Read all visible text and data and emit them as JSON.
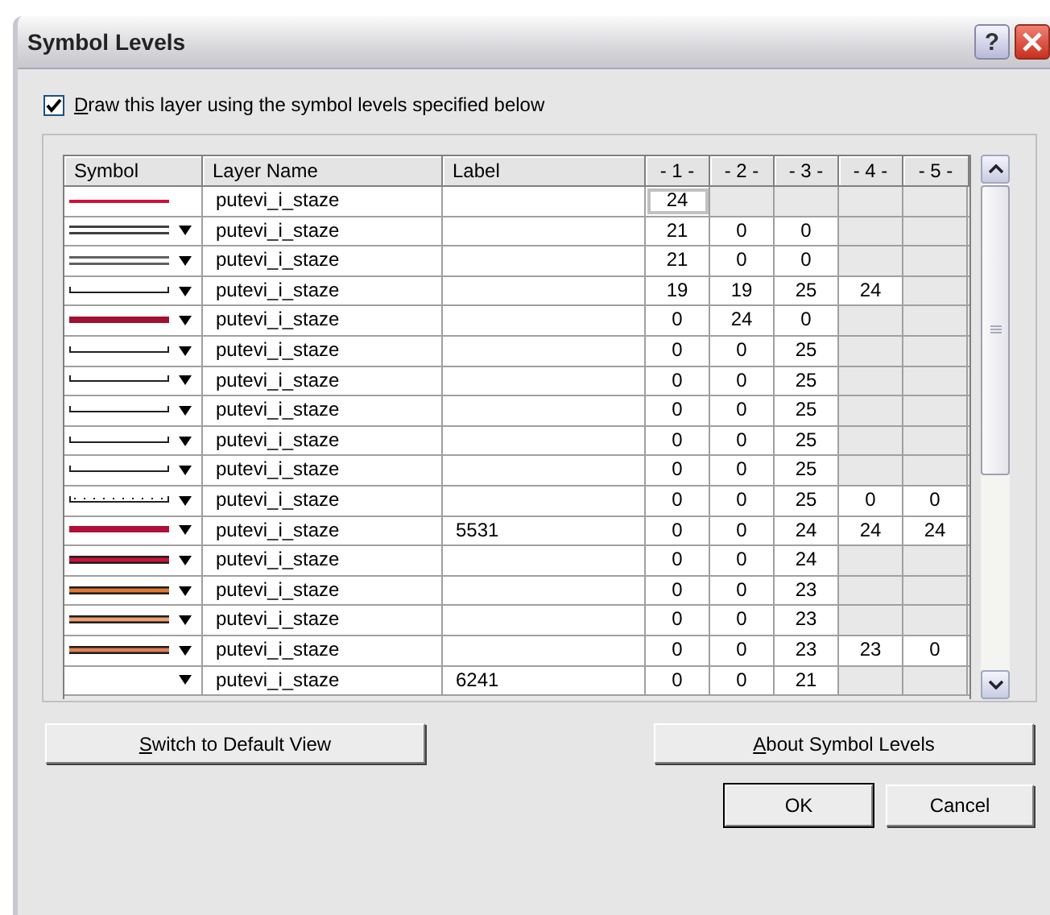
{
  "window": {
    "title": "Symbol Levels",
    "help_button": "?"
  },
  "draw_levels": {
    "label": "Draw this layer using the symbol levels specified below",
    "checked": true,
    "underline_first": true
  },
  "table": {
    "columns": [
      "Symbol",
      "Layer Name",
      "Label",
      "- 1 -",
      "- 2 -",
      "- 3 -",
      "- 4 -",
      "- 5 -"
    ],
    "rows": [
      {
        "symbol": {
          "kind": "line",
          "color": "#d0103a",
          "dropdown": false
        },
        "layer": "putevi_i_staze",
        "levels": [
          {
            "value": "24",
            "disabled": false
          },
          {
            "disabled": true
          },
          {
            "disabled": true
          },
          {
            "disabled": true
          },
          {
            "disabled": true
          }
        ],
        "focused": true
      },
      {
        "symbol": {
          "kind": "double",
          "color": "#404040",
          "dropdown": true
        },
        "layer": "putevi_i_staze",
        "levels": [
          {
            "value": "21",
            "disabled": false
          },
          {
            "value": "0",
            "disabled": false
          },
          {
            "value": "0",
            "disabled": false
          },
          {
            "disabled": true
          },
          {
            "disabled": true
          }
        ],
        "focused": false
      },
      {
        "symbol": {
          "kind": "double",
          "color": "#606060",
          "dropdown": true
        },
        "layer": "putevi_i_staze",
        "levels": [
          {
            "value": "21",
            "disabled": false
          },
          {
            "value": "0",
            "disabled": false
          },
          {
            "value": "0",
            "disabled": false
          },
          {
            "disabled": true
          },
          {
            "disabled": true
          }
        ],
        "focused": false
      },
      {
        "symbol": {
          "kind": "ticked",
          "color": "#202020",
          "dropdown": true
        },
        "layer": "putevi_i_staze",
        "levels": [
          {
            "value": "19",
            "disabled": false
          },
          {
            "value": "19",
            "disabled": false
          },
          {
            "value": "25",
            "disabled": false
          },
          {
            "value": "24",
            "disabled": false
          },
          {
            "disabled": true
          }
        ],
        "focused": false
      },
      {
        "symbol": {
          "kind": "thick",
          "color": "#a01030",
          "dropdown": true
        },
        "layer": "putevi_i_staze",
        "levels": [
          {
            "value": "0",
            "disabled": false
          },
          {
            "value": "24",
            "disabled": false
          },
          {
            "value": "0",
            "disabled": false
          },
          {
            "disabled": true
          },
          {
            "disabled": true
          }
        ],
        "focused": false
      },
      {
        "symbol": {
          "kind": "ticked",
          "color": "#202020",
          "dropdown": true
        },
        "layer": "putevi_i_staze",
        "levels": [
          {
            "value": "0",
            "disabled": false
          },
          {
            "value": "0",
            "disabled": false
          },
          {
            "value": "25",
            "disabled": false
          },
          {
            "disabled": true
          },
          {
            "disabled": true
          }
        ],
        "focused": false
      },
      {
        "symbol": {
          "kind": "ticked",
          "color": "#202020",
          "dropdown": true
        },
        "layer": "putevi_i_staze",
        "levels": [
          {
            "value": "0",
            "disabled": false
          },
          {
            "value": "0",
            "disabled": false
          },
          {
            "value": "25",
            "disabled": false
          },
          {
            "disabled": true
          },
          {
            "disabled": true
          }
        ],
        "focused": false
      },
      {
        "symbol": {
          "kind": "ticked",
          "color": "#202020",
          "dropdown": true
        },
        "layer": "putevi_i_staze",
        "levels": [
          {
            "value": "0",
            "disabled": false
          },
          {
            "value": "0",
            "disabled": false
          },
          {
            "value": "25",
            "disabled": false
          },
          {
            "disabled": true
          },
          {
            "disabled": true
          }
        ],
        "focused": false
      },
      {
        "symbol": {
          "kind": "ticked",
          "color": "#202020",
          "dropdown": true
        },
        "layer": "putevi_i_staze",
        "levels": [
          {
            "value": "0",
            "disabled": false
          },
          {
            "value": "0",
            "disabled": false
          },
          {
            "value": "25",
            "disabled": false
          },
          {
            "disabled": true
          },
          {
            "disabled": true
          }
        ],
        "focused": false
      },
      {
        "symbol": {
          "kind": "ticked",
          "color": "#202020",
          "dropdown": true
        },
        "layer": "putevi_i_staze",
        "levels": [
          {
            "value": "0",
            "disabled": false
          },
          {
            "value": "0",
            "disabled": false
          },
          {
            "value": "25",
            "disabled": false
          },
          {
            "disabled": true
          },
          {
            "disabled": true
          }
        ],
        "focused": false
      },
      {
        "symbol": {
          "kind": "dotted",
          "color": "#202020",
          "dropdown": true
        },
        "layer": "putevi_i_staze",
        "levels": [
          {
            "value": "0",
            "disabled": false
          },
          {
            "value": "0",
            "disabled": false
          },
          {
            "value": "25",
            "disabled": false
          },
          {
            "value": "0",
            "disabled": false
          },
          {
            "value": "0",
            "disabled": false
          }
        ],
        "focused": false
      },
      {
        "symbol": {
          "kind": "thick",
          "color": "#b01038",
          "dropdown": true
        },
        "layer": "putevi_i_staze",
        "label": "5531",
        "levels": [
          {
            "value": "0",
            "disabled": false
          },
          {
            "value": "0",
            "disabled": false
          },
          {
            "value": "24",
            "disabled": false
          },
          {
            "value": "24",
            "disabled": false
          },
          {
            "value": "24",
            "disabled": false
          }
        ],
        "focused": false
      },
      {
        "symbol": {
          "kind": "bordered",
          "color": "#d0103a",
          "dropdown": true
        },
        "layer": "putevi_i_staze",
        "levels": [
          {
            "value": "0",
            "disabled": false
          },
          {
            "value": "0",
            "disabled": false
          },
          {
            "value": "24",
            "disabled": false
          },
          {
            "disabled": true
          },
          {
            "disabled": true
          }
        ],
        "focused": false
      },
      {
        "symbol": {
          "kind": "bordered",
          "color": "#e07830",
          "dropdown": true
        },
        "layer": "putevi_i_staze",
        "levels": [
          {
            "value": "0",
            "disabled": false
          },
          {
            "value": "0",
            "disabled": false
          },
          {
            "value": "23",
            "disabled": false
          },
          {
            "disabled": true
          },
          {
            "disabled": true
          }
        ],
        "focused": false
      },
      {
        "symbol": {
          "kind": "bordered",
          "color": "#f0a070",
          "dropdown": true
        },
        "layer": "putevi_i_staze",
        "levels": [
          {
            "value": "0",
            "disabled": false
          },
          {
            "value": "0",
            "disabled": false
          },
          {
            "value": "23",
            "disabled": false
          },
          {
            "disabled": true
          },
          {
            "disabled": true
          }
        ],
        "focused": false
      },
      {
        "symbol": {
          "kind": "bordered",
          "color": "#e08050",
          "dropdown": true
        },
        "layer": "putevi_i_staze",
        "levels": [
          {
            "value": "0",
            "disabled": false
          },
          {
            "value": "0",
            "disabled": false
          },
          {
            "value": "23",
            "disabled": false
          },
          {
            "value": "23",
            "disabled": false
          },
          {
            "value": "0",
            "disabled": false
          }
        ],
        "focused": false
      },
      {
        "symbol": {
          "kind": "none",
          "dropdown": true
        },
        "layer": "putevi_i_staze",
        "label": "6241",
        "levels": [
          {
            "value": "0",
            "disabled": false
          },
          {
            "value": "0",
            "disabled": false
          },
          {
            "value": "21",
            "disabled": false
          },
          {
            "disabled": true
          },
          {
            "disabled": true
          }
        ],
        "focused": false
      }
    ]
  },
  "buttons": [
    {
      "label": "Switch to Default View",
      "underline_first": true,
      "default": false
    },
    {
      "label": "About Symbol Levels",
      "underline_first": true,
      "default": false
    },
    {
      "label": "OK",
      "underline_first": false,
      "default": true
    },
    {
      "label": "Cancel",
      "underline_first": false,
      "default": false
    }
  ]
}
